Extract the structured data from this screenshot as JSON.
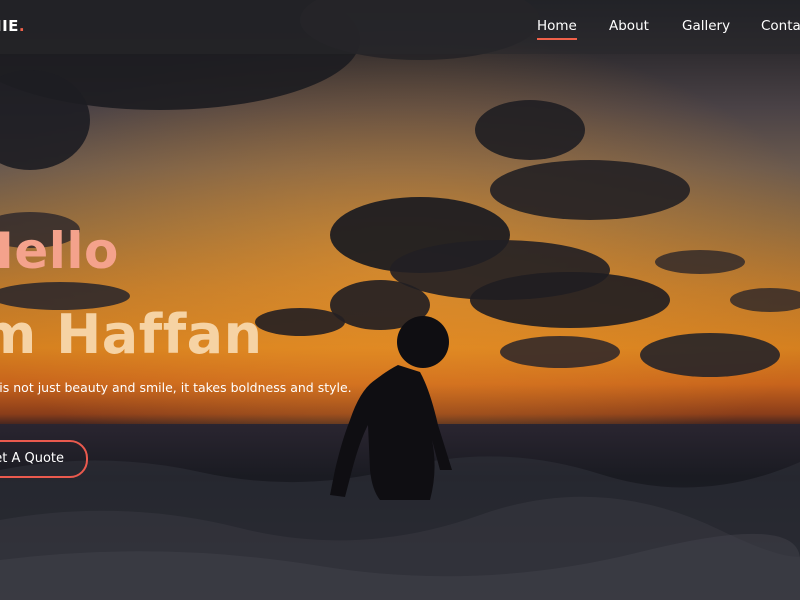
{
  "brand": {
    "text": "IIE",
    "dot": "."
  },
  "nav": {
    "items": [
      {
        "label": "Home",
        "active": true
      },
      {
        "label": "About",
        "active": false
      },
      {
        "label": "Gallery",
        "active": false
      },
      {
        "label": "Conta",
        "active": false
      }
    ]
  },
  "hero": {
    "line1": "Hello",
    "line2": "m Haffan",
    "tagline": "ing is not just beauty and smile, it takes boldness and style.",
    "cta_label": "et A Quote"
  },
  "colors": {
    "accent": "#f0614a",
    "headline_primary": "#f4a28c",
    "headline_secondary": "#f6d3a4",
    "nav_text": "#ffffff"
  }
}
